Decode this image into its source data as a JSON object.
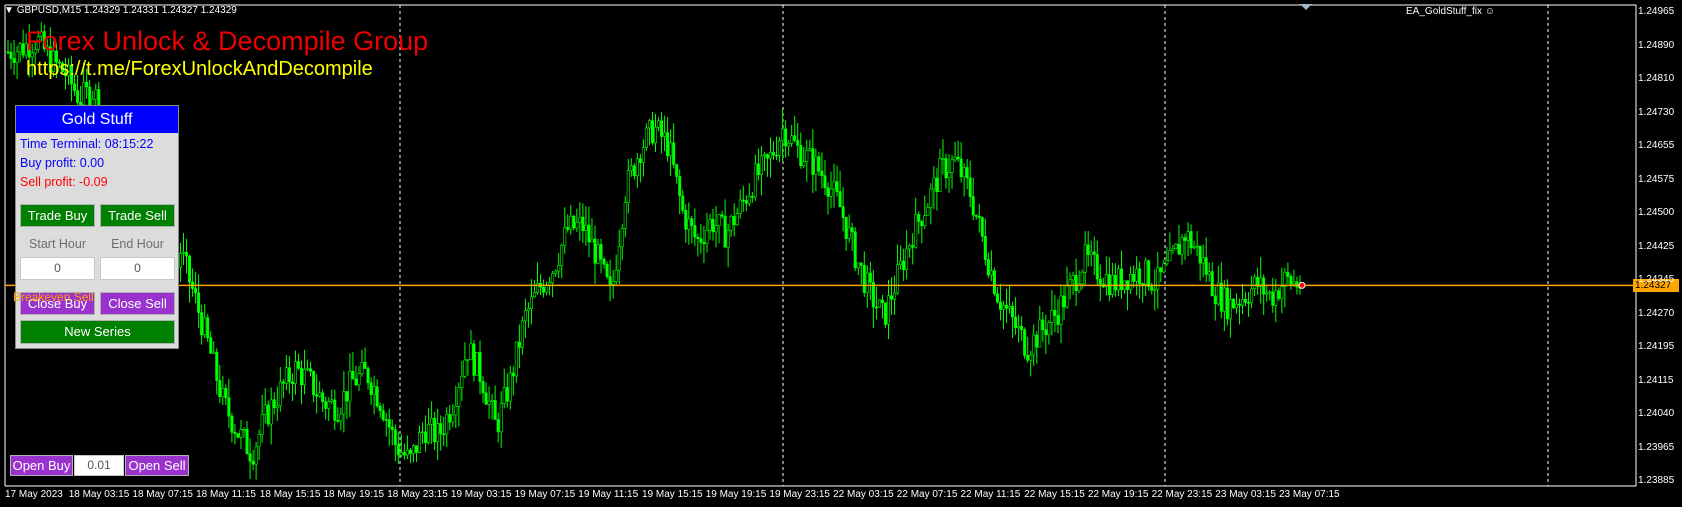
{
  "header": {
    "symbol_info": "GBPUSD,M15  1.24329 1.24331 1.24327 1.24329",
    "ea_name": "EA_GoldStuff_fix"
  },
  "brand": {
    "title": "Forex Unlock & Decompile Group",
    "url": "https://t.me/ForexUnlockAndDecompile"
  },
  "panel": {
    "title": "Gold Stuff",
    "time_terminal": "Time Terminal: 08:15:22",
    "buy_profit": "Buy profit: 0.00",
    "sell_profit": "Sell profit: -0.09",
    "trade_buy": "Trade Buy",
    "trade_sell": "Trade Sell",
    "start_hour_label": "Start Hour",
    "end_hour_label": "End Hour",
    "start_hour_value": "0",
    "end_hour_value": "0",
    "close_buy": "Close Buy",
    "close_sell": "Close Sell",
    "new_series": "New Series"
  },
  "bottom_bar": {
    "open_buy": "Open Buy",
    "lot": "0.01",
    "open_sell": "Open Sell"
  },
  "breakeven_label": "Breakeven Sell",
  "current_price": "1.24327",
  "colors": {
    "candle": "#00ff00",
    "price_line": "#ffa500",
    "panel_title": "#0000ff",
    "green_button": "#008000",
    "purple_button": "#9a32cd"
  },
  "chart_data": {
    "type": "candlestick",
    "price_axis": [
      "1.24965",
      "1.24890",
      "1.24810",
      "1.24730",
      "1.24655",
      "1.24575",
      "1.24500",
      "1.24425",
      "1.24345",
      "1.24270",
      "1.24195",
      "1.24115",
      "1.24040",
      "1.23965",
      "1.23885"
    ],
    "time_axis": [
      "17 May 2023",
      "18 May 03:15",
      "18 May 07:15",
      "18 May 11:15",
      "18 May 15:15",
      "18 May 19:15",
      "18 May 23:15",
      "19 May 03:15",
      "19 May 07:15",
      "19 May 11:15",
      "19 May 15:15",
      "19 May 19:15",
      "19 May 23:15",
      "22 May 03:15",
      "22 May 07:15",
      "22 May 11:15",
      "22 May 15:15",
      "22 May 19:15",
      "22 May 23:15",
      "23 May 03:15",
      "23 May 07:15"
    ],
    "ylim": [
      1.23885,
      1.24965
    ],
    "current_price": 1.24327,
    "grid": false,
    "price_path": [
      [
        0,
        1.2488
      ],
      [
        3,
        1.2489
      ],
      [
        6,
        1.2491
      ],
      [
        9,
        1.2486
      ],
      [
        12,
        1.2483
      ],
      [
        15,
        1.2477
      ],
      [
        18,
        1.2479
      ],
      [
        21,
        1.2465
      ],
      [
        24,
        1.2452
      ],
      [
        27,
        1.244
      ],
      [
        30,
        1.2432
      ],
      [
        33,
        1.2422
      ],
      [
        36,
        1.2441
      ],
      [
        39,
        1.243
      ],
      [
        42,
        1.2418
      ],
      [
        45,
        1.2405
      ],
      [
        48,
        1.2398
      ],
      [
        51,
        1.2393
      ],
      [
        54,
        1.2402
      ],
      [
        57,
        1.2408
      ],
      [
        60,
        1.2413
      ],
      [
        63,
        1.241
      ],
      [
        66,
        1.2405
      ],
      [
        69,
        1.2404
      ],
      [
        72,
        1.241
      ],
      [
        75,
        1.2412
      ],
      [
        78,
        1.2405
      ],
      [
        81,
        1.2395
      ],
      [
        84,
        1.2391
      ],
      [
        87,
        1.2399
      ],
      [
        90,
        1.2397
      ],
      [
        93,
        1.2405
      ],
      [
        96,
        1.2418
      ],
      [
        99,
        1.2411
      ],
      [
        102,
        1.2399
      ],
      [
        105,
        1.241
      ],
      [
        108,
        1.2425
      ],
      [
        111,
        1.2432
      ],
      [
        114,
        1.2437
      ],
      [
        117,
        1.2446
      ],
      [
        120,
        1.2447
      ],
      [
        123,
        1.244
      ],
      [
        126,
        1.243
      ],
      [
        129,
        1.2455
      ],
      [
        132,
        1.2465
      ],
      [
        135,
        1.247
      ],
      [
        138,
        1.2466
      ],
      [
        141,
        1.245
      ],
      [
        144,
        1.2443
      ],
      [
        147,
        1.2448
      ],
      [
        150,
        1.2445
      ],
      [
        153,
        1.2451
      ],
      [
        156,
        1.2458
      ],
      [
        159,
        1.2462
      ],
      [
        162,
        1.247
      ],
      [
        165,
        1.2465
      ],
      [
        168,
        1.2462
      ],
      [
        171,
        1.2458
      ],
      [
        174,
        1.2451
      ],
      [
        177,
        1.244
      ],
      [
        180,
        1.2431
      ],
      [
        183,
        1.2425
      ],
      [
        186,
        1.2435
      ],
      [
        189,
        1.2445
      ],
      [
        192,
        1.2452
      ],
      [
        195,
        1.246
      ],
      [
        198,
        1.2462
      ],
      [
        201,
        1.2455
      ],
      [
        204,
        1.2442
      ],
      [
        207,
        1.243
      ],
      [
        210,
        1.2424
      ],
      [
        213,
        1.2418
      ],
      [
        216,
        1.2422
      ],
      [
        219,
        1.2426
      ],
      [
        222,
        1.2432
      ],
      [
        225,
        1.2439
      ],
      [
        228,
        1.2436
      ],
      [
        231,
        1.2433
      ],
      [
        234,
        1.2435
      ],
      [
        237,
        1.2436
      ],
      [
        240,
        1.2433
      ],
      [
        243,
        1.2438
      ],
      [
        246,
        1.2445
      ],
      [
        249,
        1.244
      ],
      [
        252,
        1.2432
      ],
      [
        255,
        1.2428
      ],
      [
        258,
        1.243
      ],
      [
        261,
        1.2433
      ],
      [
        264,
        1.243
      ],
      [
        267,
        1.2434
      ],
      [
        270,
        1.24329
      ]
    ]
  }
}
